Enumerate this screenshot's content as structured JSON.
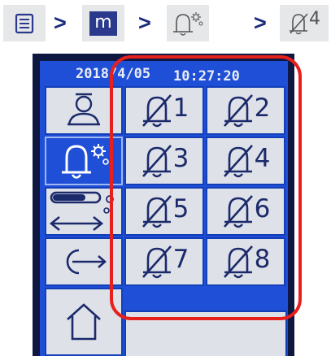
{
  "breadcrumb": {
    "separator": ">",
    "menu_icon": "menu-list-icon",
    "m_label": "m",
    "settings_icon": "bell-settings-icon",
    "muted_bell_number": "4"
  },
  "status_bar": {
    "date": "2018/4/05",
    "time": "10:27:20"
  },
  "side_menu": [
    {
      "icon": "user-icon",
      "active": false
    },
    {
      "icon": "bell-settings-icon",
      "active": true
    },
    {
      "icon": "progress-settings-icon",
      "active": false
    },
    {
      "icon": "logout-icon",
      "active": false
    },
    {
      "icon": "home-icon",
      "active": false
    }
  ],
  "alarm_grid": {
    "icon": "muted-bell-icon",
    "cells": [
      {
        "label": "1"
      },
      {
        "label": "2"
      },
      {
        "label": "3"
      },
      {
        "label": "4"
      },
      {
        "label": "5"
      },
      {
        "label": "6"
      },
      {
        "label": "7"
      },
      {
        "label": "8"
      }
    ]
  },
  "colors": {
    "screen_blue": "#1f4fd6",
    "button_face": "#dfe1e8",
    "icon_ink": "#1b2a6b",
    "highlight_red": "#e8201d",
    "breadcrumb_navy": "#1b2c7e"
  }
}
